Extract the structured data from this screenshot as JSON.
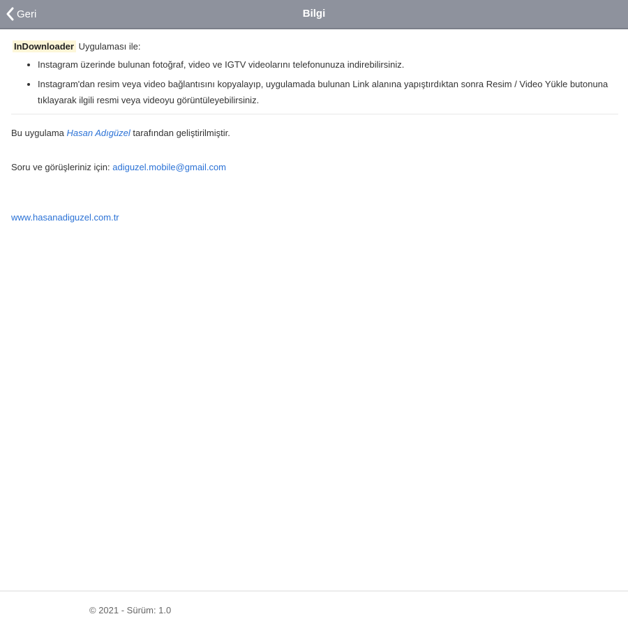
{
  "navbar": {
    "back_label": "Geri",
    "title": "Bilgi",
    "background": "#8e929d"
  },
  "intro": {
    "brand": "InDownloader",
    "suffix": " Uygulaması ile:"
  },
  "features": [
    "Instagram üzerinde bulunan fotoğraf, video ve IGTV videolarını telefonunuza indirebilirsiniz.",
    "Instagram'dan resim veya video bağlantısını kopyalayıp, uygulamada bulunan Link alanına yapıştırdıktan sonra Resim / Video Yükle butonuna tıklayarak ilgili resmi veya videoyu görüntüleyebilirsiniz."
  ],
  "developer": {
    "prefix": "Bu uygulama ",
    "name": "Hasan Adıgüzel",
    "suffix": " tarafından geliştirilmiştir."
  },
  "contact": {
    "prefix": "Soru ve görüşleriniz için: ",
    "email": "adiguzel.mobile@gmail.com"
  },
  "website": "www.hasanadiguzel.com.tr",
  "footer": {
    "text": "© 2021 - Sürüm: 1.0"
  },
  "colors": {
    "link": "#2b72d6",
    "brand_highlight": "#fdf6d8"
  }
}
